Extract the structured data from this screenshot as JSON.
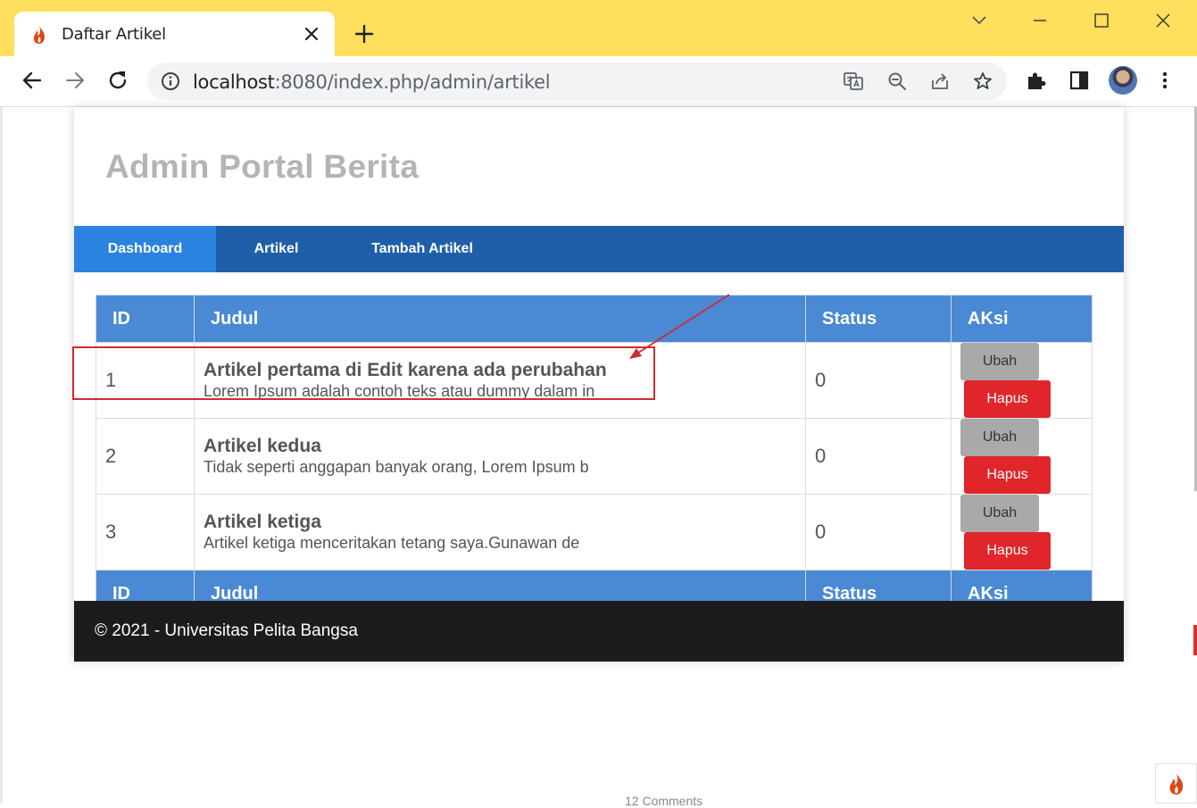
{
  "browser": {
    "tab_title": "Daftar Artikel",
    "url_host": "localhost",
    "url_rest": ":8080/index.php/admin/artikel"
  },
  "site": {
    "title": "Admin Portal Berita",
    "nav": [
      {
        "label": "Dashboard",
        "active": true
      },
      {
        "label": "Artikel",
        "active": false
      },
      {
        "label": "Tambah Artikel",
        "active": false
      }
    ]
  },
  "table": {
    "headers": [
      "ID",
      "Judul",
      "Status",
      "AKsi"
    ],
    "rows": [
      {
        "id": "1",
        "title": "Artikel pertama di Edit karena ada perubahan",
        "excerpt": "Lorem Ipsum adalah contoh teks atau dummy dalam in",
        "status": "0"
      },
      {
        "id": "2",
        "title": "Artikel kedua",
        "excerpt": "Tidak seperti anggapan banyak orang, Lorem Ipsum b",
        "status": "0"
      },
      {
        "id": "3",
        "title": "Artikel ketiga",
        "excerpt": "Artikel ketiga menceritakan tetang saya.Gunawan de",
        "status": "0"
      }
    ],
    "edit_label": "Ubah",
    "delete_label": "Hapus"
  },
  "footer": {
    "text": "© 2021 - Universitas Pelita Bangsa"
  },
  "background_text": "12 Comments",
  "colors": {
    "browser_frame": "#ffdf5d",
    "navbar": "#1f5faa",
    "nav_active": "#2b83e0",
    "table_header": "#4a89d4",
    "delete_button": "#e0262b",
    "edit_button": "#a9a9a9",
    "footer": "#1c1c1c",
    "annotation": "#d22a33"
  },
  "icons": [
    "codeigniter-flame-icon",
    "close-icon",
    "plus-icon",
    "chevron-down-icon",
    "minimize-icon",
    "maximize-icon",
    "window-close-icon",
    "back-icon",
    "forward-icon",
    "reload-icon",
    "info-icon",
    "translate-icon",
    "zoom-out-icon",
    "share-icon",
    "star-icon",
    "extensions-icon",
    "side-panel-icon",
    "avatar",
    "more-icon"
  ]
}
